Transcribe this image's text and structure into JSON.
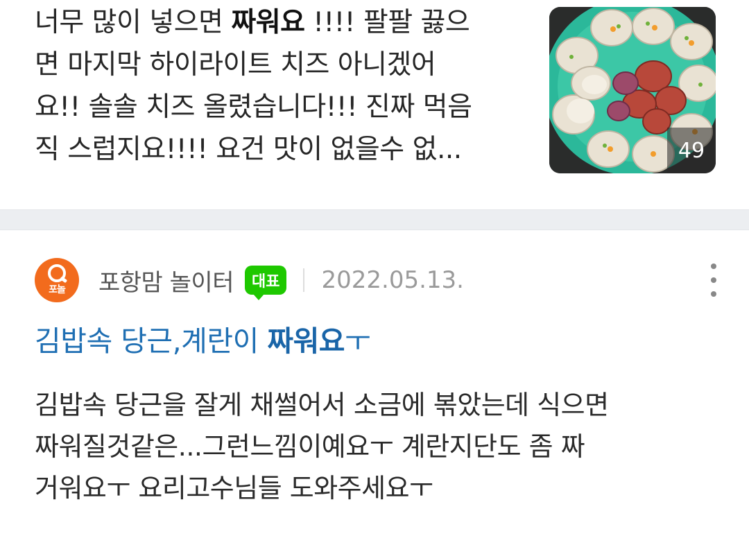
{
  "top_result": {
    "snippet_lines": [
      {
        "pre": "너무 많이 넣으면 ",
        "hl": "짜워요",
        "post": " !!!! 팔팔 끓으"
      },
      {
        "pre": "면 마지막 하이라이트 치즈 아니겠어",
        "hl": "",
        "post": ""
      },
      {
        "pre": "요!! 솔솔 치즈 올렸습니다!!! 진짜 먹음",
        "hl": "",
        "post": ""
      },
      {
        "pre": "직 스럽지요!!!! 요건 맛이 없을수 없...",
        "hl": "",
        "post": ""
      }
    ],
    "thumbnail": {
      "icon": "scallops-photo",
      "photo_count": "49"
    }
  },
  "result": {
    "cafe": {
      "avatar_text": "포놀",
      "name": "포항맘 놀이터",
      "badge": "대표"
    },
    "date": "2022.05.13.",
    "more_icon": "more-vertical-icon",
    "title": {
      "pre": "김밥속 당근,계란이 ",
      "hl": "짜워요",
      "post": "ㅜ"
    },
    "body_lines": [
      "김밥속 당근을 잘게 채썰어서 소금에 볶았는데 식으면",
      "짜워질것같은...그런느낌이예요ㅜ 계란지단도 좀 짜",
      "거워요ㅜ 요리고수님들 도와주세요ㅜ"
    ]
  },
  "colors": {
    "title_link": "#1f6fb3",
    "badge_green": "#1ec800",
    "avatar_orange": "#f26b1d",
    "date_gray": "#9a9a9a",
    "divider": "#eceef1"
  }
}
